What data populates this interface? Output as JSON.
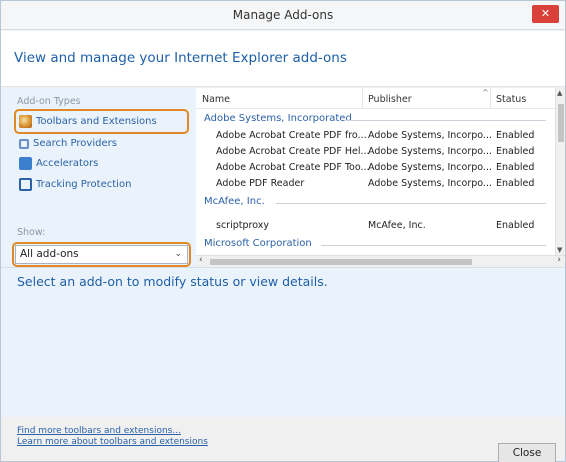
{
  "window": {
    "title": "Manage Add-ons",
    "close_glyph": "✕"
  },
  "header": {
    "heading": "View and manage your Internet Explorer add-ons"
  },
  "sidebar": {
    "types_label": "Add-on Types",
    "items": [
      {
        "label": "Toolbars and Extensions",
        "icon": "toolbar-extension-icon"
      },
      {
        "label": "Search Providers",
        "icon": "search-icon"
      },
      {
        "label": "Accelerators",
        "icon": "accelerator-icon"
      },
      {
        "label": "Tracking Protection",
        "icon": "tracking-protection-icon"
      }
    ],
    "show_label": "Show:",
    "show_value": "All add-ons"
  },
  "list": {
    "columns": [
      "Name",
      "Publisher",
      "Status"
    ],
    "groups": [
      {
        "name": "Adobe Systems, Incorporated",
        "rows": [
          {
            "name": "Adobe Acrobat Create PDF fro...",
            "publisher": "Adobe Systems, Incorpo...",
            "status": "Enabled"
          },
          {
            "name": "Adobe Acrobat Create PDF Hel...",
            "publisher": "Adobe Systems, Incorpo...",
            "status": "Enabled"
          },
          {
            "name": "Adobe Acrobat Create PDF Too...",
            "publisher": "Adobe Systems, Incorpo...",
            "status": "Enabled"
          },
          {
            "name": "Adobe PDF Reader",
            "publisher": "Adobe Systems, Incorpo...",
            "status": "Enabled"
          }
        ]
      },
      {
        "name": "McAfee, Inc.",
        "rows": [
          {
            "name": "scriptproxy",
            "publisher": "McAfee, Inc.",
            "status": "Enabled"
          }
        ]
      },
      {
        "name": "Microsoft Corporation",
        "rows": []
      }
    ]
  },
  "details": {
    "message": "Select an add-on to modify status or view details."
  },
  "footer": {
    "link1": "Find more toolbars and extensions...",
    "link2": "Learn more about toolbars and extensions",
    "close_label": "Close"
  }
}
